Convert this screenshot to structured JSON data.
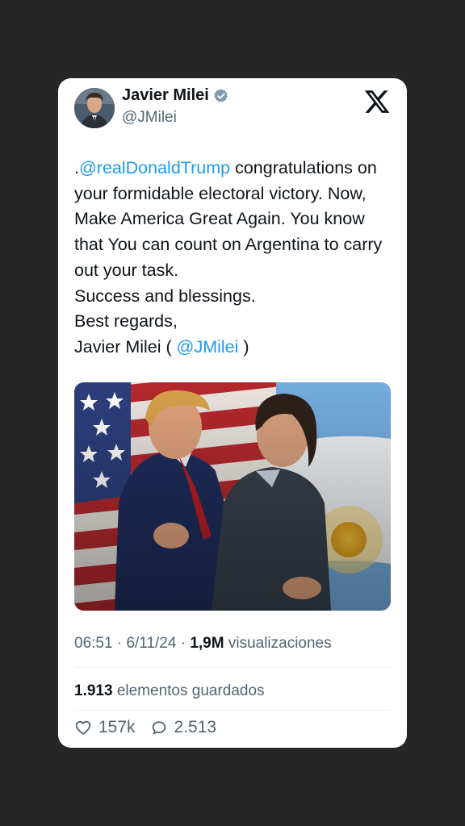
{
  "author": {
    "name": "Javier Milei",
    "handle": "@JMilei",
    "verified": true,
    "avatar": "profile-photo"
  },
  "logo": "x-logo-icon",
  "tweet": {
    "prefix": ".",
    "mention1": "@realDonaldTrump",
    "text_main": " congratulations on your formidable electoral victory. Now, Make America Great Again. You know that You can count on Argentina to carry out your task.\nSuccess and blessings.\nBest regards,\nJavier Milei ( ",
    "mention2": "@JMilei",
    "suffix": " )"
  },
  "media": {
    "description": "photo"
  },
  "meta": {
    "time": "06:51",
    "sep1": " · ",
    "date": "6/11/24",
    "sep2": " · ",
    "views_count": "1,9M",
    "views_label": " visualizaciones"
  },
  "saved": {
    "count": "1.913",
    "label": " elementos guardados"
  },
  "actions": {
    "likes": "157k",
    "replies": "2.513"
  },
  "colors": {
    "mention": "#1d9bf0",
    "verified": "#829aab",
    "background": "#262626"
  }
}
